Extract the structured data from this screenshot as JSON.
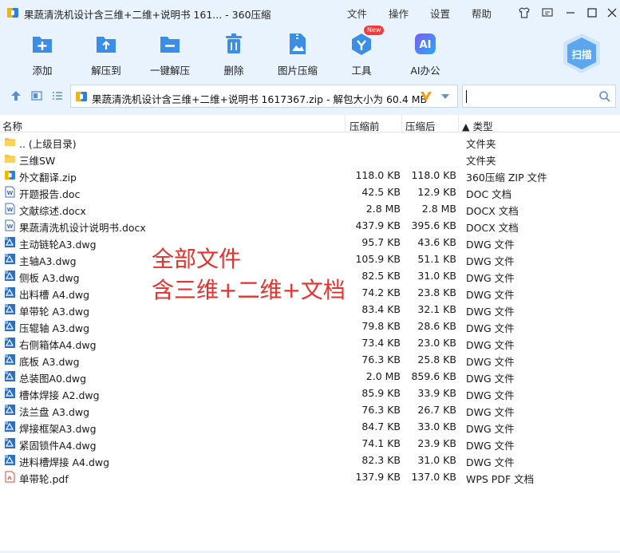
{
  "window": {
    "title": "果蔬清洗机设计含三维+二维+说明书 161... - 360压缩",
    "menu": [
      "文件",
      "操作",
      "设置",
      "帮助"
    ]
  },
  "toolbar": {
    "add": "添加",
    "extract": "解压到",
    "one_click": "一键解压",
    "delete": "删除",
    "image_compress": "图片压缩",
    "tools": "工具",
    "tools_badge": "New",
    "ai_office": "AI办公",
    "scan": "扫描"
  },
  "address": {
    "path": "果蔬清洗机设计含三维+二维+说明书 1617367.zip - 解包大小为 60.4 MB",
    "search_placeholder": ""
  },
  "columns": {
    "name": "名称",
    "packed": "压缩前",
    "after": "压缩后",
    "type": "▲ 类型"
  },
  "files": [
    {
      "icon": "folder-icon",
      "name": ".. (上级目录)",
      "before": "",
      "after": "",
      "type": "文件夹"
    },
    {
      "icon": "folder-icon",
      "name": "三维SW",
      "before": "",
      "after": "",
      "type": "文件夹"
    },
    {
      "icon": "zip-icon",
      "name": "外文翻译.zip",
      "before": "118.0 KB",
      "after": "118.0 KB",
      "type": "360压缩 ZIP 文件"
    },
    {
      "icon": "doc-icon",
      "name": "开题报告.doc",
      "before": "42.5 KB",
      "after": "12.9 KB",
      "type": "DOC 文档"
    },
    {
      "icon": "doc-icon",
      "name": "文献综述.docx",
      "before": "2.8 MB",
      "after": "2.8 MB",
      "type": "DOCX 文档"
    },
    {
      "icon": "doc-icon",
      "name": "果蔬清洗机设计说明书.docx",
      "before": "437.9 KB",
      "after": "395.6 KB",
      "type": "DOCX 文档"
    },
    {
      "icon": "dwg-icon",
      "name": "主动链轮A3.dwg",
      "before": "95.7 KB",
      "after": "43.6 KB",
      "type": "DWG 文件"
    },
    {
      "icon": "dwg-icon",
      "name": "主轴A3.dwg",
      "before": "105.9 KB",
      "after": "51.1 KB",
      "type": "DWG 文件"
    },
    {
      "icon": "dwg-icon",
      "name": "侧板 A3.dwg",
      "before": "82.5 KB",
      "after": "31.0 KB",
      "type": "DWG 文件"
    },
    {
      "icon": "dwg-icon",
      "name": "出料槽 A4.dwg",
      "before": "74.2 KB",
      "after": "23.8 KB",
      "type": "DWG 文件"
    },
    {
      "icon": "dwg-icon",
      "name": "单带轮 A3.dwg",
      "before": "83.4 KB",
      "after": "32.1 KB",
      "type": "DWG 文件"
    },
    {
      "icon": "dwg-icon",
      "name": "压辊轴 A3.dwg",
      "before": "79.8 KB",
      "after": "28.6 KB",
      "type": "DWG 文件"
    },
    {
      "icon": "dwg-icon",
      "name": "右侧箱体A4.dwg",
      "before": "73.4 KB",
      "after": "23.0 KB",
      "type": "DWG 文件"
    },
    {
      "icon": "dwg-icon",
      "name": "底板 A3.dwg",
      "before": "76.3 KB",
      "after": "25.8 KB",
      "type": "DWG 文件"
    },
    {
      "icon": "dwg-icon",
      "name": "总装图A0.dwg",
      "before": "2.0 MB",
      "after": "859.6 KB",
      "type": "DWG 文件"
    },
    {
      "icon": "dwg-icon",
      "name": "槽体焊接 A2.dwg",
      "before": "85.9 KB",
      "after": "33.9 KB",
      "type": "DWG 文件"
    },
    {
      "icon": "dwg-icon",
      "name": "法兰盘 A3.dwg",
      "before": "76.3 KB",
      "after": "26.7 KB",
      "type": "DWG 文件"
    },
    {
      "icon": "dwg-icon",
      "name": "焊接框架A3.dwg",
      "before": "84.7 KB",
      "after": "33.0 KB",
      "type": "DWG 文件"
    },
    {
      "icon": "dwg-icon",
      "name": "紧固锁件A4.dwg",
      "before": "74.1 KB",
      "after": "23.9 KB",
      "type": "DWG 文件"
    },
    {
      "icon": "dwg-icon",
      "name": "进料槽焊接 A4.dwg",
      "before": "82.3 KB",
      "after": "31.0 KB",
      "type": "DWG 文件"
    },
    {
      "icon": "pdf-icon",
      "name": "单带轮.pdf",
      "before": "137.9 KB",
      "after": "137.0 KB",
      "type": "WPS PDF 文档"
    }
  ],
  "overlay": {
    "line1": "全部文件",
    "line2": "含三维+二维+文档"
  }
}
